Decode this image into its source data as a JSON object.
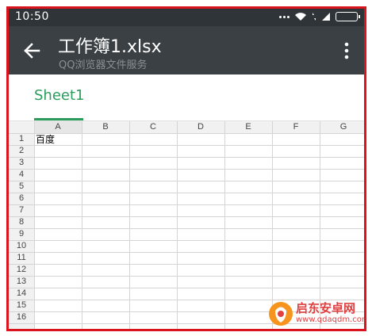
{
  "status": {
    "time": "10:50"
  },
  "appbar": {
    "title": "工作簿1.xlsx",
    "subtitle": "QQ浏览器文件服务"
  },
  "tabs": [
    {
      "label": "Sheet1",
      "active": true
    }
  ],
  "grid": {
    "columns": [
      "A",
      "B",
      "C",
      "D",
      "E",
      "F",
      "G"
    ],
    "rows": [
      "1",
      "2",
      "3",
      "4",
      "5",
      "6",
      "7",
      "8",
      "9",
      "10",
      "11",
      "12",
      "13",
      "14",
      "15",
      "16"
    ],
    "cells": {
      "A1": "百度"
    }
  },
  "watermark": {
    "text": "启东安卓网",
    "url": "www.qdaqdm.com"
  },
  "colors": {
    "accent": "#2a9c5c",
    "appbar": "#3a4044",
    "statusbar": "#2e3438",
    "frame": "#d9141c"
  }
}
